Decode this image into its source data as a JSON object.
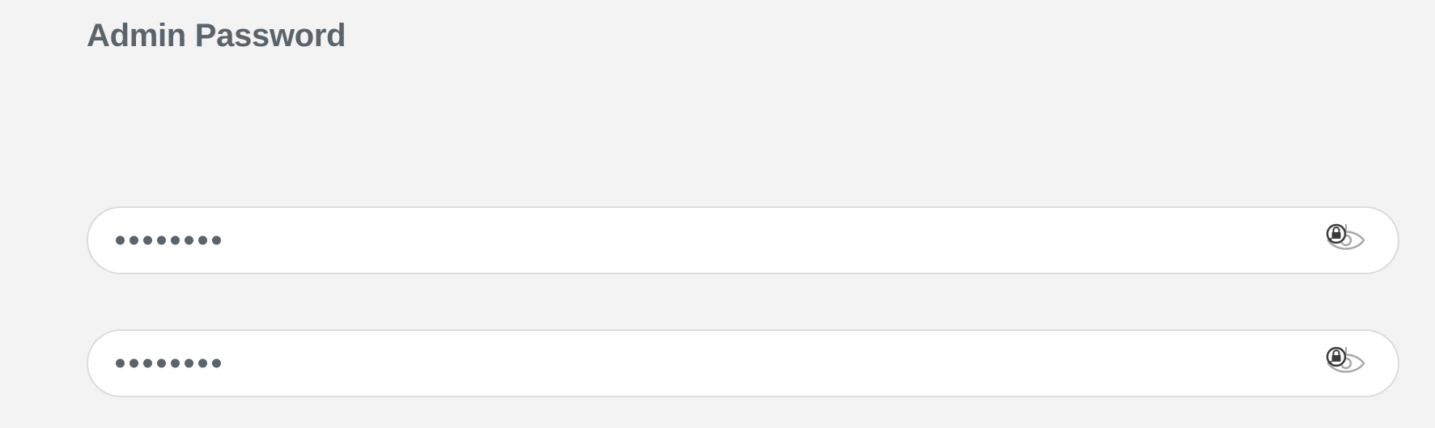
{
  "section": {
    "title": "Admin Password"
  },
  "fields": [
    {
      "masked_value": "••••••••",
      "icon": "eye-slash-icon",
      "badge_icon": "lock-refresh-icon"
    },
    {
      "masked_value": "••••••••",
      "icon": "eye-slash-icon",
      "badge_icon": "lock-refresh-icon"
    }
  ],
  "colors": {
    "background": "#f3f3f3",
    "text": "#5b636b",
    "field_border": "#dcdcdc",
    "icon_gray": "#a8a8a8",
    "badge_dark": "#3b3b3b"
  }
}
